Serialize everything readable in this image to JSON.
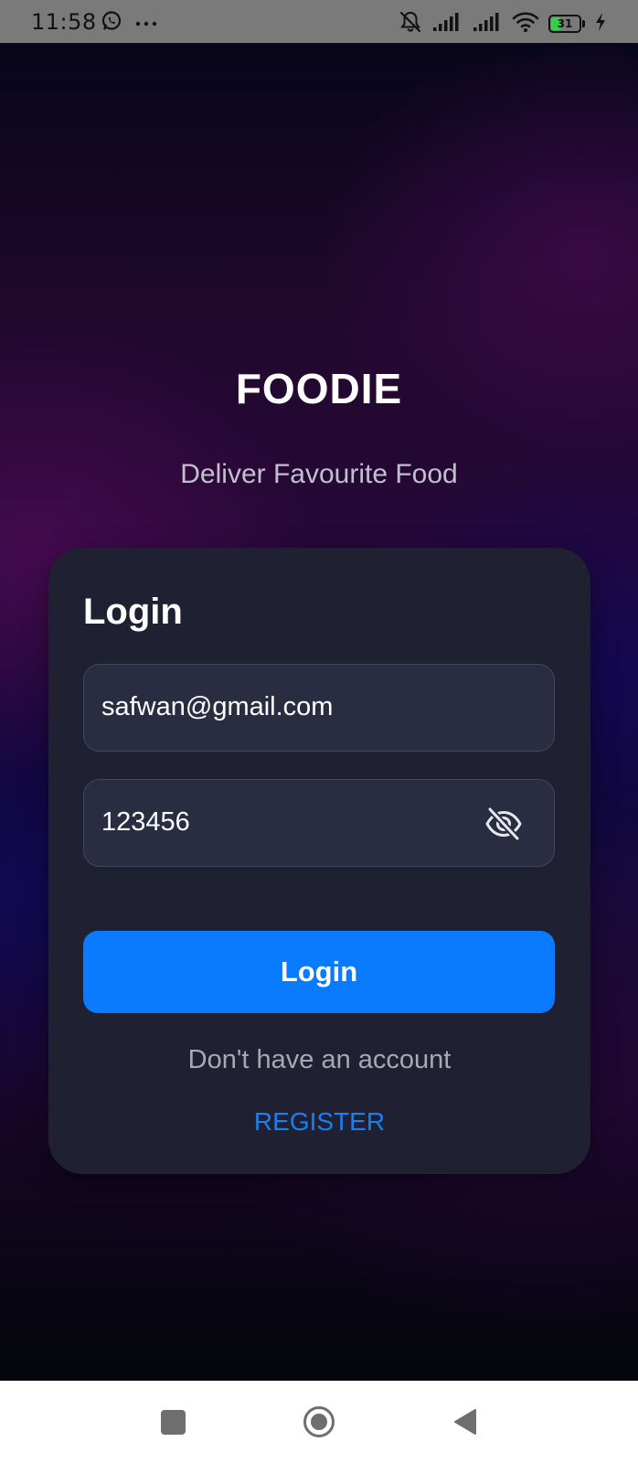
{
  "status_bar": {
    "time": "11:58",
    "battery_level": "31",
    "icons": [
      "whatsapp-icon",
      "more-dots-icon",
      "notifications-off-icon",
      "signal-icon",
      "signal-icon",
      "wifi-icon",
      "battery-icon",
      "charging-bolt-icon"
    ]
  },
  "app": {
    "title": "FOODIE",
    "subtitle": "Deliver Favourite Food"
  },
  "login": {
    "heading": "Login",
    "email_value": "safwan@gmail.com",
    "password_value": "123456",
    "password_toggle_icon": "eye-off-icon",
    "submit_label": "Login",
    "no_account_text": "Don't have an account",
    "register_label": "REGISTER"
  },
  "colors": {
    "accent": "#0a7aff",
    "link": "#1a7ff0",
    "card": "#1f2133",
    "field": "#2a2c41"
  },
  "nav_bar": {
    "buttons": [
      "recents-icon",
      "home-icon",
      "back-icon"
    ]
  }
}
